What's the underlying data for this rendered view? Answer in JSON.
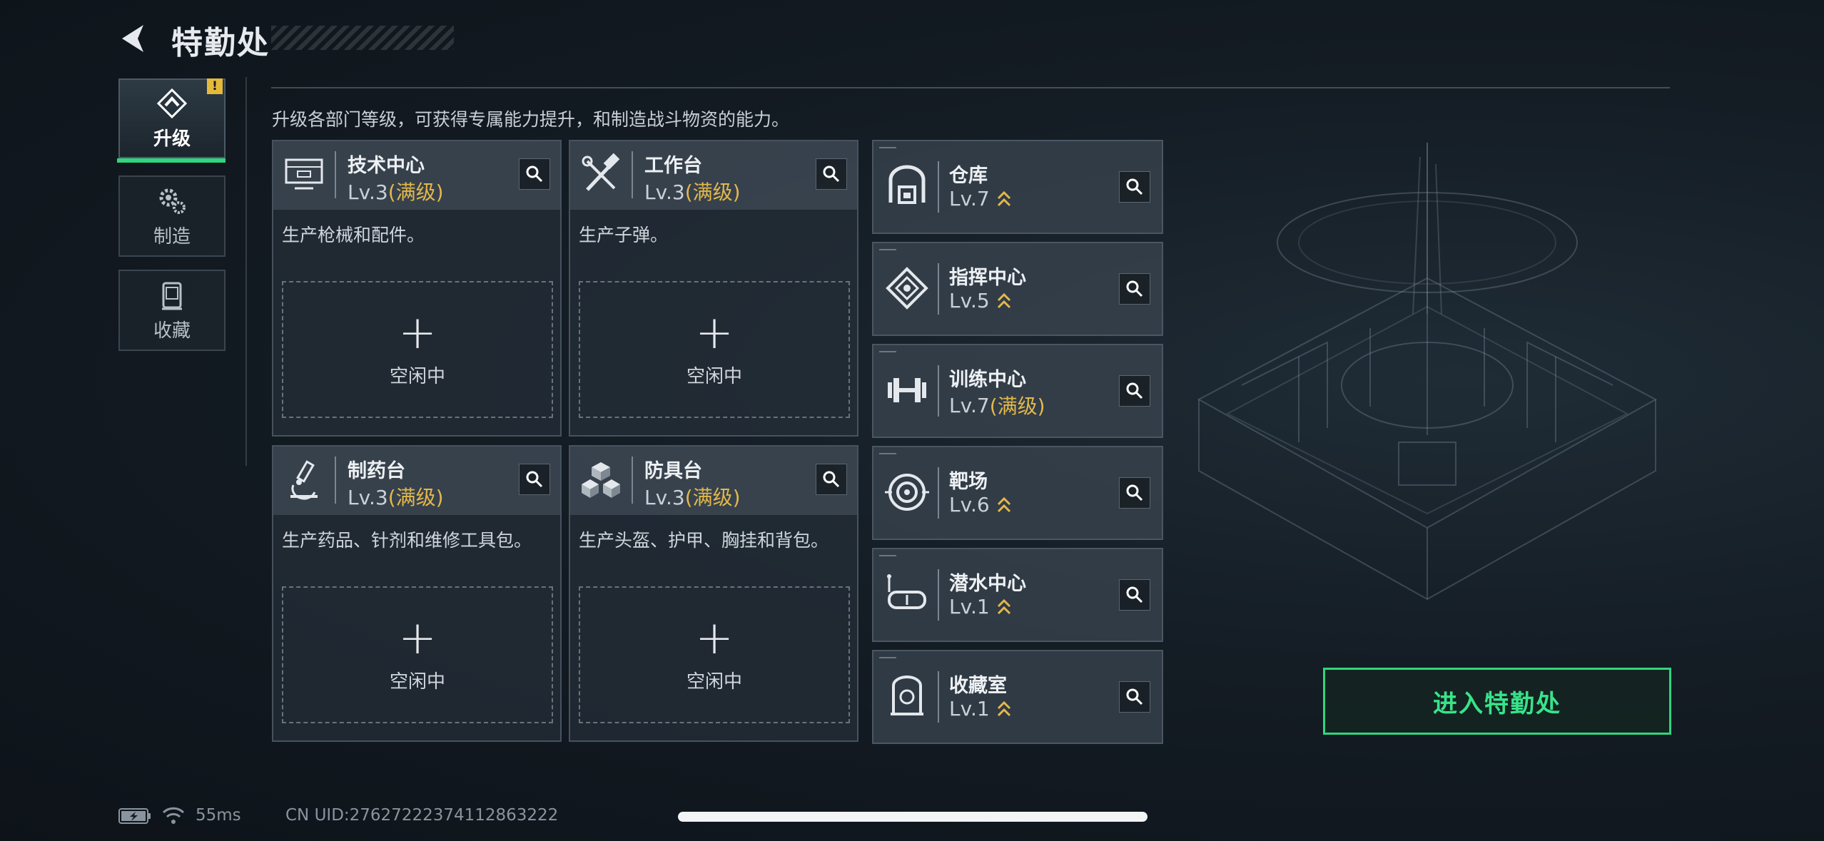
{
  "header": {
    "title": "特勤处"
  },
  "nav": [
    {
      "label": "升级",
      "icon": "upgrade-icon",
      "active": true,
      "badge": "!"
    },
    {
      "label": "制造",
      "icon": "gears-icon",
      "active": false
    },
    {
      "label": "收藏",
      "icon": "collection-icon",
      "active": false
    }
  ],
  "description": "升级各部门等级，可获得专属能力提升，和制造战斗物资的能力。",
  "departments": [
    {
      "name": "技术中心",
      "level": "Lv.3",
      "max": "(满级)",
      "desc": "生产枪械和配件。",
      "slot_plus": "+",
      "slot_label": "空闲中",
      "icon": "monitor-icon"
    },
    {
      "name": "工作台",
      "level": "Lv.3",
      "max": "(满级)",
      "desc": "生产子弹。",
      "slot_plus": "+",
      "slot_label": "空闲中",
      "icon": "tools-icon"
    },
    {
      "name": "制药台",
      "level": "Lv.3",
      "max": "(满级)",
      "desc": "生产药品、针剂和维修工具包。",
      "slot_plus": "+",
      "slot_label": "空闲中",
      "icon": "microscope-icon"
    },
    {
      "name": "防具台",
      "level": "Lv.3",
      "max": "(满级)",
      "desc": "生产头盔、护甲、胸挂和背包。",
      "slot_plus": "+",
      "slot_label": "空闲中",
      "icon": "cubes-icon"
    }
  ],
  "facilities": [
    {
      "name": "仓库",
      "level": "Lv.7",
      "max": "",
      "upgradable": true,
      "icon": "warehouse-icon"
    },
    {
      "name": "指挥中心",
      "level": "Lv.5",
      "max": "",
      "upgradable": true,
      "icon": "command-icon"
    },
    {
      "name": "训练中心",
      "level": "Lv.7",
      "max": "(满级)",
      "upgradable": false,
      "icon": "dumbbell-icon"
    },
    {
      "name": "靶场",
      "level": "Lv.6",
      "max": "",
      "upgradable": true,
      "icon": "target-icon"
    },
    {
      "name": "潜水中心",
      "level": "Lv.1",
      "max": "",
      "upgradable": true,
      "icon": "diving-mask-icon"
    },
    {
      "name": "收藏室",
      "level": "Lv.1",
      "max": "",
      "upgradable": true,
      "icon": "trophy-case-icon"
    }
  ],
  "enter_button": "进入特勤处",
  "status": {
    "ping": "55ms",
    "uid": "CN UID:2762722237411286322​2"
  },
  "colors": {
    "accent_green": "#2fd67d",
    "max_gold": "#e3b84b",
    "warning": "#e5b93a"
  }
}
